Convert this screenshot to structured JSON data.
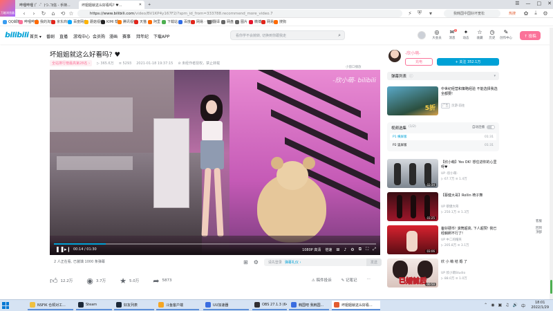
{
  "browser": {
    "logo_text": "万能浏览器",
    "tabs": [
      {
        "label": "哔哩哔哩 (゜-゜)つ...",
        "active": false
      },
      {
        "label": "飞信 - 手持...",
        "active": false
      },
      {
        "label": "坏姐姐就这么好看吗? ♥...",
        "active": true
      }
    ],
    "url_main": "https://www.bilibili.com",
    "url_rest": "/video/BV1KP4y167F2/?spm_id_from=333788.recommend_more_video.7",
    "search_placeholder": "我韩国中国好坏宽松",
    "window_controls": [
      "☰",
      "—",
      "□",
      "✕"
    ],
    "bookmarks": [
      {
        "label": "QQ邮箱",
        "color": "#3a9cf0"
      },
      {
        "label": "哔哩哔哩",
        "color": "#fb7299"
      },
      {
        "label": "我的淘宝",
        "color": "#ff6a00"
      },
      {
        "label": "京东商城",
        "color": "#e1251b"
      },
      {
        "label": "百度网盘",
        "color": "#06a7ff"
      },
      {
        "label": "蘑菇视频",
        "color": "#ffb400"
      },
      {
        "label": "KIMI 帮",
        "color": "#222"
      },
      {
        "label": "腾讯视频",
        "color": "#ff7a00"
      },
      {
        "label": "天猫",
        "color": "#e1251b"
      },
      {
        "label": "阿里",
        "color": "#ff6a00"
      },
      {
        "label": "下载站",
        "color": "#4caf50"
      },
      {
        "label": "百度",
        "color": "#2f6ce5"
      },
      {
        "label": "网易 · 有道",
        "color": "#e1251b"
      },
      {
        "label": "翻译",
        "color": "#666"
      },
      {
        "label": "网盘",
        "color": "#666"
      },
      {
        "label": "图片",
        "color": "#666"
      },
      {
        "label": "微博",
        "color": "#e6162d"
      },
      {
        "label": "网易",
        "color": "#e1251b"
      },
      {
        "label": "搜狗",
        "color": "#ff6a00"
      }
    ]
  },
  "header": {
    "logo": "bilibili",
    "nav": [
      "首页 ▾",
      "番剧",
      "直播",
      "游戏中心",
      "会员购",
      "漫画",
      "赛事",
      "拜年纪",
      "下载APP"
    ],
    "search_placeholder": "看你学不会婉转, 切换到你跟我走",
    "icons": [
      {
        "label": "大会员",
        "glyph": "◎"
      },
      {
        "label": "消息",
        "glyph": "✉",
        "badge": "2"
      },
      {
        "label": "动态",
        "glyph": "✦"
      },
      {
        "label": "收藏",
        "glyph": "☆"
      },
      {
        "label": "历史",
        "glyph": "◷"
      },
      {
        "label": "创作中心",
        "glyph": "✎"
      }
    ],
    "upload": "↑ 投稿"
  },
  "video": {
    "title": "坏姐姐就这么好看吗? ♥",
    "rank_tag": "全站排行榜最高第28名 ›",
    "views": "365.6万",
    "danmaku": "5293",
    "date": "2021-01-18 19:37:15",
    "copyright": "未经作者授权，禁止转载",
    "watermark": "-欣小萌- bilibili",
    "danmaku_toggle": "小窗口播放",
    "time": "00:14 / 01:30",
    "progress": 0.16,
    "quality": "1080P 高清",
    "speed": "倍速",
    "ctrl_icons": [
      "⊞",
      "♪",
      "⚙",
      "⧉",
      "⛶",
      "⤢"
    ]
  },
  "viewers": "2 人正在看, 已装填 1000 条弹幕",
  "danmaku_bar": {
    "placeholder": "请先登录",
    "etiquette": "弹幕礼仪 ›",
    "send": "发送"
  },
  "actions": {
    "like": "12.2万",
    "coin": "3.7万",
    "fav": "5.0万",
    "share": "5873",
    "report": "稿件投诉",
    "note": "记笔记"
  },
  "up": {
    "name": "-欣小萌-",
    "desc": "",
    "charge": "充电",
    "follow": "+ 关注 352.1万"
  },
  "danmaku_list": "弹幕列表",
  "ad": {
    "title": "中世纪经营和策略经验 不能选择我选全都要!",
    "tag_pill": "广告",
    "tag_up": "页游·前往",
    "thumb_text": "5折"
  },
  "playlist": {
    "title": "视频选集",
    "sub": "(1/2)",
    "autoplay": "自动连播",
    "items": [
      {
        "label": "P1 横屏版",
        "dur": "01:31"
      },
      {
        "label": "P2 竖屏版",
        "dur": "01:31"
      }
    ]
  },
  "recommendations": [
    {
      "title": "【欣小萌】Yes OK! 想住进你的心里呀♥",
      "up": "UP -欣小萌-",
      "stats": "▷ 67.7万  ≡ 1.4万",
      "dur": "02:34"
    },
    {
      "title": "【蔡健大哥】Rollin 椅子舞",
      "up": "UP 蔡健大哥",
      "stats": "▷ 250.1万  ≡ 1.3万",
      "dur": "01:25"
    },
    {
      "title": "备好硬币! 滚筒超高, 下人超赞! 我已经躺刷不行了!",
      "up": "UP 中二的帽夹",
      "stats": "▷ 205.8万  ≡ 3.1万",
      "dur": "03:06"
    },
    {
      "title": "欣 小 萌 结 婚 了",
      "up": "UP 欣小萌Studio",
      "stats": "▷ 88.0万  ≡ 1.0万",
      "dur": "00:50",
      "overlay": "已婚前后"
    }
  ],
  "side_tools": [
    "客服",
    "回到",
    "顶部"
  ],
  "taskbar": {
    "items": [
      {
        "label": "NSFIK 仓颉对工...",
        "color": "#f0c040"
      },
      {
        "label": "Steam",
        "color": "#1b2838"
      },
      {
        "label": "好友列表",
        "color": "#1b2838"
      },
      {
        "label": "斗鱼客户端",
        "color": "#f5a623"
      },
      {
        "label": "UU加速器",
        "color": "#3a6de0"
      },
      {
        "label": "OBS 27.1.3 (64-bi...",
        "color": "#302e31"
      },
      {
        "label": "韩国吧 我韩国...",
        "color": "#3a6de0"
      },
      {
        "label": "坏姐姐就这么好看...",
        "color": "#e25c30"
      }
    ],
    "tray": [
      "⌃",
      "◉",
      "▣",
      "♫",
      "🔊",
      "中"
    ],
    "time": "18:01",
    "date": "2022/1/29"
  }
}
